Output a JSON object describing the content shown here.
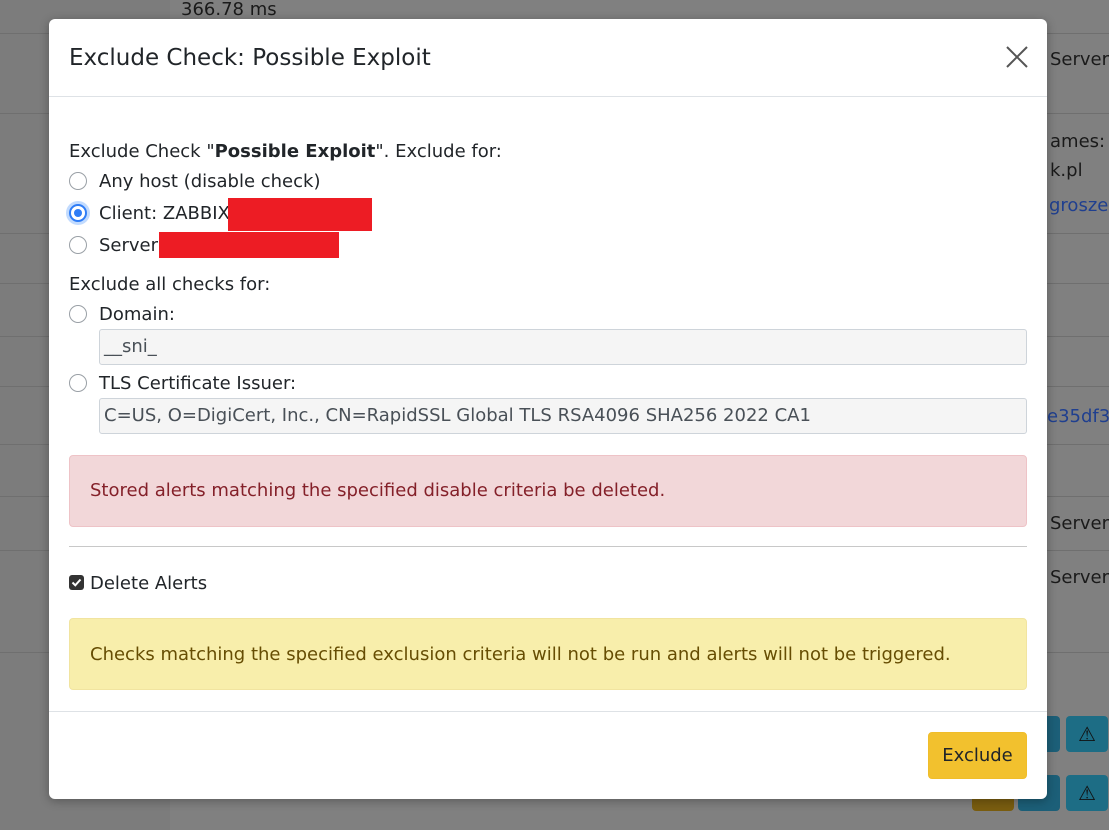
{
  "background": {
    "top_value": "366.78 ms",
    "right_fragments": [
      "Server",
      "ames:",
      "k.pl",
      "groszek",
      "e35df3",
      "Server",
      "Server"
    ]
  },
  "modal": {
    "title": "Exclude Check: Possible Exploit",
    "intro": {
      "prefix": "Exclude Check \"",
      "check_name": "Possible Exploit",
      "suffix": "\". Exclude for:"
    },
    "options": {
      "any_host": "Any host (disable check)",
      "client": "Client: ZABBIX",
      "server": "Server:"
    },
    "exclude_all_label": "Exclude all checks for:",
    "domain": {
      "label": "Domain:",
      "value": "__sni_"
    },
    "tls_issuer": {
      "label": "TLS Certificate Issuer:",
      "value": "C=US, O=DigiCert, Inc., CN=RapidSSL Global TLS RSA4096 SHA256 2022 CA1"
    },
    "danger_alert": "Stored alerts matching the specified disable criteria be deleted.",
    "delete_alerts": {
      "label": "Delete Alerts",
      "checked": true
    },
    "warning_alert": "Checks matching the specified exclusion criteria will not be run and alerts will not be triggered.",
    "exclude_button": "Exclude",
    "selected_option": "client"
  },
  "colors": {
    "primary": "#2f7df6",
    "warning_button": "#f2c12e",
    "danger_bg": "#f2d7d9",
    "warning_bg": "#f8eeab",
    "redaction": "#ed1c24"
  }
}
